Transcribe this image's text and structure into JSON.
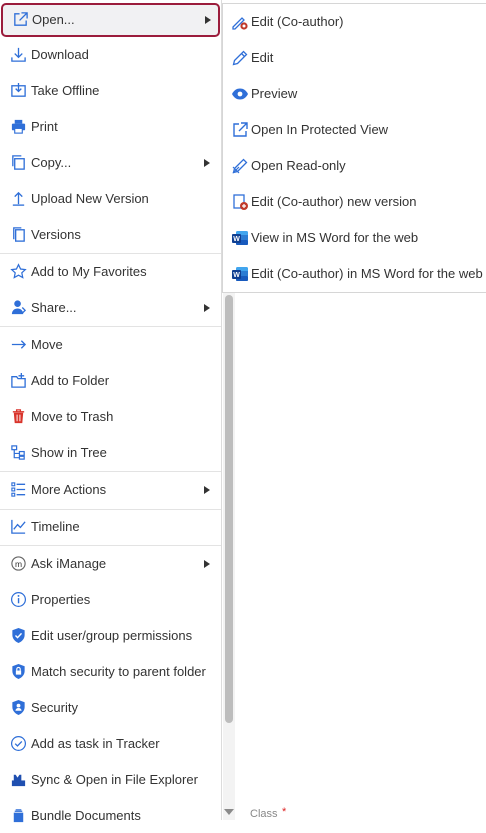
{
  "menu": {
    "items": [
      {
        "label": "Open...",
        "icon": "open-external-icon",
        "submenu": true,
        "selected": true
      },
      {
        "label": "Download",
        "icon": "download-icon"
      },
      {
        "label": "Take Offline",
        "icon": "take-offline-icon"
      },
      {
        "label": "Print",
        "icon": "printer-icon"
      },
      {
        "label": "Copy...",
        "icon": "copy-icon",
        "submenu": true
      },
      {
        "label": "Upload New Version",
        "icon": "upload-icon"
      },
      {
        "label": "Versions",
        "icon": "versions-icon"
      },
      {
        "label": "Add to My Favorites",
        "icon": "star-icon"
      },
      {
        "label": "Share...",
        "icon": "share-person-icon",
        "submenu": true
      },
      {
        "label": "Move",
        "icon": "arrow-right-icon"
      },
      {
        "label": "Add to Folder",
        "icon": "add-to-folder-icon"
      },
      {
        "label": "Move to Trash",
        "icon": "trash-icon"
      },
      {
        "label": "Show in Tree",
        "icon": "tree-icon"
      },
      {
        "label": "More Actions",
        "icon": "list-icon",
        "submenu": true
      },
      {
        "label": "Timeline",
        "icon": "timeline-chart-icon"
      },
      {
        "label": "Ask iManage",
        "icon": "imanage-ai-icon",
        "submenu": true
      },
      {
        "label": "Properties",
        "icon": "info-icon"
      },
      {
        "label": "Edit user/group permissions",
        "icon": "shield-check-icon"
      },
      {
        "label": "Match security to parent folder",
        "icon": "shield-lock-icon"
      },
      {
        "label": "Security",
        "icon": "shield-user-icon"
      },
      {
        "label": "Add as task in Tracker",
        "icon": "check-circle-icon"
      },
      {
        "label": "Sync & Open in File Explorer",
        "icon": "sync-explorer-icon"
      },
      {
        "label": "Bundle Documents",
        "icon": "bundle-icon"
      }
    ]
  },
  "submenu": {
    "items": [
      {
        "label": "Edit (Co-author)",
        "icon": "coauthor-edit-icon"
      },
      {
        "label": "Edit",
        "icon": "pencil-icon"
      },
      {
        "label": "Preview",
        "icon": "eye-icon"
      },
      {
        "label": "Open In Protected View",
        "icon": "open-external-icon"
      },
      {
        "label": "Open Read-only",
        "icon": "pencil-crossed-icon"
      },
      {
        "label": "Edit (Co-author) new version",
        "icon": "new-version-icon"
      },
      {
        "label": "View in MS Word for the web",
        "icon": "word-icon"
      },
      {
        "label": "Edit (Co-author) in MS Word for the web",
        "icon": "word-icon"
      }
    ]
  },
  "background": {
    "stray_text": "Class",
    "stray_required": "*"
  },
  "colors": {
    "accent": "#9b1c3c",
    "icon_blue": "#2f6fd8",
    "trash_red": "#d9342b",
    "word_blue": "#185abd"
  }
}
